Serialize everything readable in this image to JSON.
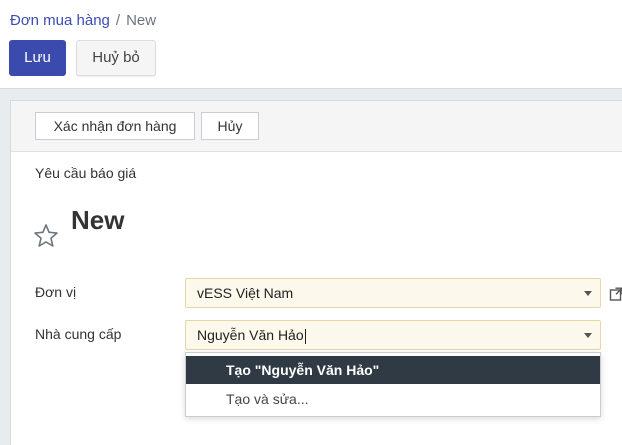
{
  "breadcrumb": {
    "parent": "Đơn mua hàng",
    "separator": "/",
    "current": "New"
  },
  "actions": {
    "save_label": "Lưu",
    "discard_label": "Huỷ bỏ"
  },
  "statusbar": {
    "confirm_label": "Xác nhận đơn hàng",
    "cancel_label": "Hủy"
  },
  "form": {
    "state_label": "Yêu cầu báo giá",
    "record_name": "New",
    "fields": {
      "company": {
        "label": "Đơn vị",
        "value": "vESS Việt Nam"
      },
      "vendor": {
        "label": "Nhà cung cấp",
        "value": "Nguyễn Văn Hảo"
      }
    }
  },
  "dropdown": {
    "items": [
      {
        "label": "Tạo \"Nguyễn Văn Hảo\""
      },
      {
        "label": "Tạo và sửa..."
      }
    ]
  },
  "colors": {
    "primary": "#3a4aad",
    "link": "#3d4cb0",
    "input_bg": "#fdf8ec",
    "highlight": "#2f3a44"
  },
  "icons": {
    "favorite": "star-outline-icon",
    "open_record": "external-link-icon",
    "dropdown": "caret-down-icon"
  }
}
